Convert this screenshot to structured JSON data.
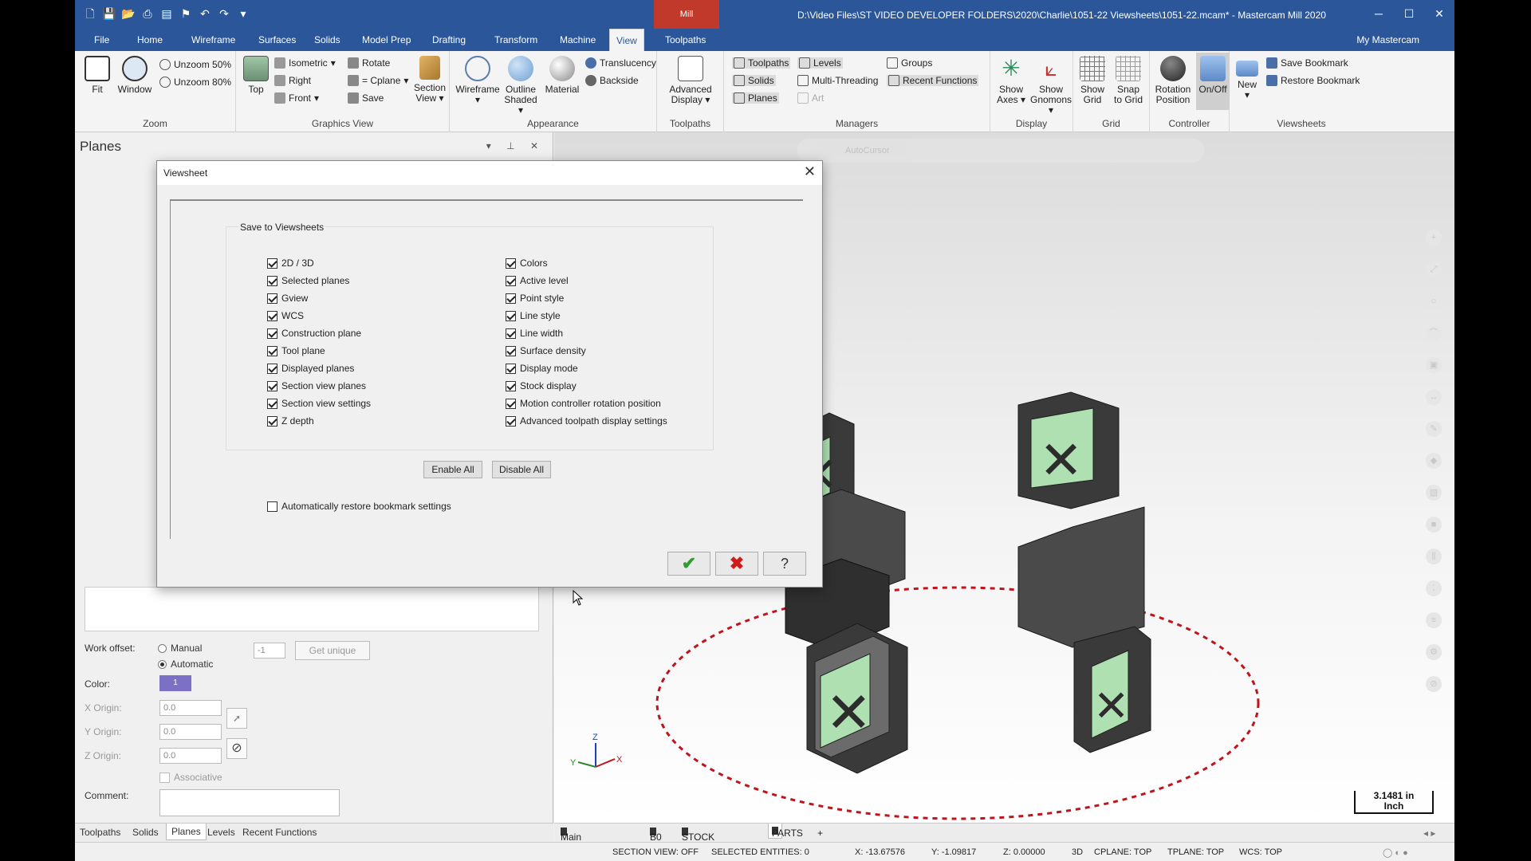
{
  "title": "D:\\Video Files\\ST VIDEO DEVELOPER FOLDERS\\2020\\Charlie\\1051-22 Viewsheets\\1051-22.mcam* - Mastercam Mill 2020",
  "context_tab": "Mill",
  "menu_tabs": [
    "File",
    "Home",
    "Wireframe",
    "Surfaces",
    "Solids",
    "Model Prep",
    "Drafting",
    "Transform",
    "Machine",
    "View",
    "Toolpaths"
  ],
  "my_mastercam": "My Mastercam",
  "ribbon": {
    "zoom": {
      "label": "Zoom",
      "fit": "Fit",
      "window": "Window",
      "unzoom50": "Unzoom 50%",
      "unzoom80": "Unzoom 80%"
    },
    "graphics_view": {
      "label": "Graphics View",
      "top": "Top",
      "isometric": "Isometric",
      "right": "Right",
      "front": "Front",
      "rotate": "Rotate",
      "cplane": "= Cplane",
      "save": "Save",
      "section_view_1": "Section",
      "section_view_2": "View"
    },
    "appearance": {
      "label": "Appearance",
      "wireframe": "Wireframe",
      "outline_1": "Outline",
      "outline_2": "Shaded",
      "material": "Material",
      "translucency": "Translucency",
      "backside": "Backside"
    },
    "toolpaths": {
      "label": "Toolpaths",
      "advanced_1": "Advanced",
      "advanced_2": "Display"
    },
    "managers": {
      "label": "Managers",
      "toolpaths": "Toolpaths",
      "solids": "Solids",
      "planes": "Planes",
      "levels": "Levels",
      "multithreading": "Multi-Threading",
      "art": "Art",
      "groups": "Groups",
      "recent": "Recent Functions"
    },
    "display": {
      "label": "Display",
      "show_axes_1": "Show",
      "show_axes_2": "Axes",
      "show_gnomons_1": "Show",
      "show_gnomons_2": "Gnomons"
    },
    "grid": {
      "label": "Grid",
      "show_grid_1": "Show",
      "show_grid_2": "Grid",
      "snap_1": "Snap",
      "snap_2": "to Grid"
    },
    "controller": {
      "label": "Controller",
      "rotation_1": "Rotation",
      "rotation_2": "Position",
      "onoff": "On/Off"
    },
    "viewsheets": {
      "label": "Viewsheets",
      "new": "New",
      "save_bookmark": "Save Bookmark",
      "restore_bookmark": "Restore Bookmark"
    }
  },
  "panel": {
    "title": "Planes",
    "work_offset": "Work offset:",
    "manual": "Manual",
    "automatic": "Automatic",
    "offset_value": "-1",
    "get_unique": "Get unique",
    "color": "Color:",
    "color_value": "1",
    "x_origin": "X Origin:",
    "y_origin": "Y Origin:",
    "z_origin": "Z Origin:",
    "x_value": "0.0",
    "y_value": "0.0",
    "z_value": "0.0",
    "associative": "Associative",
    "comment": "Comment:"
  },
  "bottom_tabs": [
    "Toolpaths",
    "Solids",
    "Planes",
    "Levels",
    "Recent Functions"
  ],
  "dialog": {
    "title": "Viewsheet",
    "group_title": "Save to Viewsheets",
    "left_items": [
      "2D / 3D",
      "Selected planes",
      "Gview",
      "WCS",
      "Construction plane",
      "Tool plane",
      "Displayed planes",
      "Section view planes",
      "Section view settings",
      "Z depth"
    ],
    "right_items": [
      "Colors",
      "Active level",
      "Point style",
      "Line style",
      "Line width",
      "Surface density",
      "Display mode",
      "Stock display",
      "Motion controller rotation position",
      "Advanced toolpath display settings"
    ],
    "enable_all": "Enable All",
    "disable_all": "Disable All",
    "auto_restore": "Automatically restore bookmark settings",
    "ok_glyph": "✔",
    "cancel_glyph": "✖",
    "help_glyph": "?"
  },
  "viewport": {
    "toolbar_label": "AutoCursor",
    "scale_value": "3.1481 in",
    "scale_unit": "Inch",
    "gnomon_x": "X",
    "gnomon_y": "Y",
    "gnomon_z": "Z"
  },
  "viewsheet_tabs": [
    "Main Viewsheet",
    "B0",
    "STOCK MODELS",
    "PARTS",
    "+"
  ],
  "status": {
    "section_view": "SECTION VIEW: OFF",
    "selected": "SELECTED ENTITIES: 0",
    "x": "X:   -13.67576",
    "y": "Y:   -1.09817",
    "z": "Z:   0.00000",
    "mode": "3D",
    "cplane": "CPLANE: TOP",
    "tplane": "TPLANE: TOP",
    "wcs": "WCS: TOP"
  },
  "colors": {
    "accent": "#2b579a",
    "check_ok": "#2f9e2f",
    "cancel": "#d11a1a",
    "dash_circle": "#c0141c",
    "part": "#3c3c3c",
    "pocket": "#aee0b1"
  }
}
